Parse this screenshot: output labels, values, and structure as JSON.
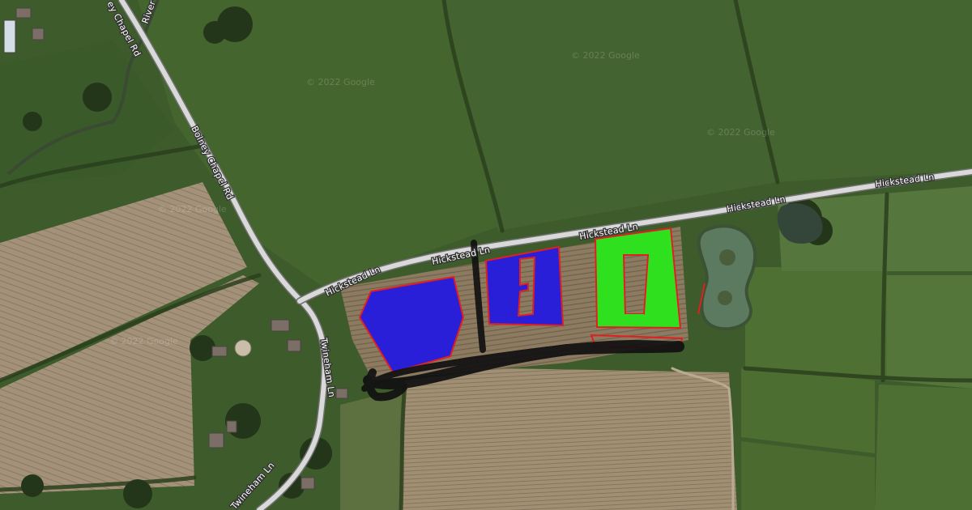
{
  "map": {
    "roads": {
      "river_label": "River",
      "bolney_chapel_rd_upper": "ey Chapel Rd",
      "bolney_chapel_rd": "Bolney Chapel Rd",
      "hickstead_ln_1": "Hickstead Ln",
      "hickstead_ln_2": "Hickstead Ln",
      "hickstead_ln_3": "Hickstead Ln",
      "hickstead_ln_4": "Hickstead Ln",
      "hickstead_ln_5": "Hickstead Ln",
      "twineham_ln_upper": "Twineham Ln",
      "twineham_ln_lower": "Twineham Ln"
    },
    "watermark": "© 2022 Google",
    "colors": {
      "grass_field": "#3f5e2c",
      "crop_field": "#8a7a60",
      "road": "#d8d8d8",
      "blue_overlay": "#2a1fd8",
      "green_overlay": "#2fe01f",
      "overlay_outline": "#e02020",
      "drawn_path": "#111111"
    }
  }
}
